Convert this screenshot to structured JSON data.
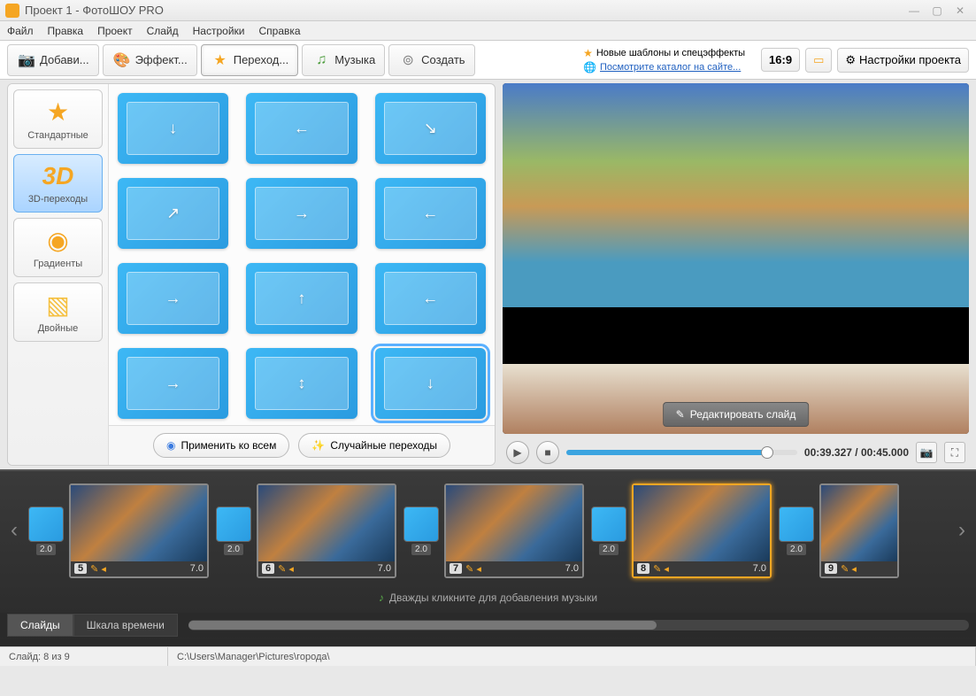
{
  "window": {
    "title": "Проект 1 - ФотоШОУ PRO"
  },
  "menu": [
    "Файл",
    "Правка",
    "Проект",
    "Слайд",
    "Настройки",
    "Справка"
  ],
  "tabs": {
    "add": "Добави...",
    "effects": "Эффект...",
    "transitions": "Переход...",
    "music": "Музыка",
    "create": "Создать"
  },
  "header_links": {
    "templates": "Новые шаблоны и спецэффекты",
    "catalog": "Посмотрите каталог на сайте..."
  },
  "aspect": "16:9",
  "settings_btn": "Настройки проекта",
  "categories": [
    {
      "label": "Стандартные",
      "icon": "⭐"
    },
    {
      "label": "3D-переходы",
      "icon": "3D",
      "active": true
    },
    {
      "label": "Градиенты",
      "icon": "◉"
    },
    {
      "label": "Двойные",
      "icon": "▧"
    }
  ],
  "transitions_grid": [
    {
      "arrow": "↓"
    },
    {
      "arrow": "←"
    },
    {
      "arrow": "↘"
    },
    {
      "arrow": "↗"
    },
    {
      "arrow": "→"
    },
    {
      "arrow": "←"
    },
    {
      "arrow": "→"
    },
    {
      "arrow": "↑"
    },
    {
      "arrow": "←"
    },
    {
      "arrow": "→"
    },
    {
      "arrow": "↕"
    },
    {
      "arrow": "↓",
      "selected": true
    }
  ],
  "grid_actions": {
    "apply_all": "Применить ко всем",
    "random": "Случайные переходы"
  },
  "preview": {
    "edit_btn": "Редактировать слайд",
    "time": "00:39.327 / 00:45.000"
  },
  "timeline": {
    "slides": [
      {
        "num": "5",
        "dur": "7.0",
        "trans": "2.0"
      },
      {
        "num": "6",
        "dur": "7.0",
        "trans": "2.0"
      },
      {
        "num": "7",
        "dur": "7.0",
        "trans": "2.0"
      },
      {
        "num": "8",
        "dur": "7.0",
        "trans": "2.0",
        "selected": true
      },
      {
        "num": "9",
        "trans": "2.0",
        "narrow": true
      }
    ],
    "music_hint": "Дважды кликните для добавления музыки",
    "tabs": {
      "slides": "Слайды",
      "time": "Шкала времени"
    }
  },
  "status": {
    "slide": "Слайд: 8 из 9",
    "path": "C:\\Users\\Manager\\Pictures\\города\\"
  }
}
